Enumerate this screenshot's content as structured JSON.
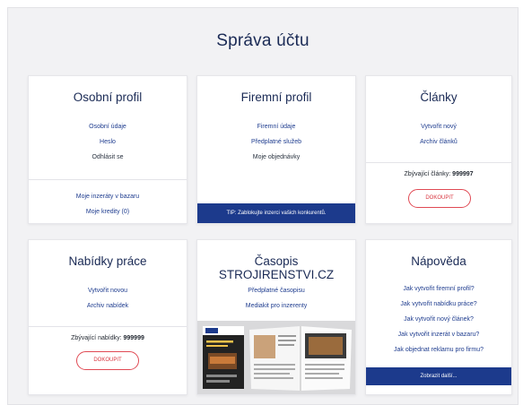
{
  "page": {
    "title": "Správa účtu"
  },
  "cards": {
    "personal": {
      "title": "Osobní profil",
      "links": [
        "Osobní údaje",
        "Heslo",
        "Odhlásit se"
      ],
      "bottom_links": [
        "Moje inzeráty v bazaru",
        "Moje kredity (0)"
      ]
    },
    "company": {
      "title": "Firemní profil",
      "links": [
        "Firemní údaje",
        "Předplatné služeb",
        "Moje objednávky"
      ],
      "tip": "TIP: Zablokujte inzerci vašich konkurentů."
    },
    "articles": {
      "title": "Články",
      "links": [
        "Vytvořit nový",
        "Archiv článků"
      ],
      "remaining_label": "Zbývající články:",
      "remaining_value": "999997",
      "buy_label": "DOKOUPIT"
    },
    "jobs": {
      "title": "Nabídky práce",
      "links": [
        "Vytvořit novou",
        "Archiv nabídek"
      ],
      "remaining_label": "Zbývající nabídky:",
      "remaining_value": "999999",
      "buy_label": "DOKOUPIT"
    },
    "magazine": {
      "title": "Časopis STROJIRENSTVI.CZ",
      "links": [
        "Předplatné časopisu",
        "Mediakit pro inzerenty"
      ]
    },
    "help": {
      "title": "Nápověda",
      "links": [
        "Jak vytvořit firemní profil?",
        "Jak vytvořit nabídku práce?",
        "Jak vytvořit nový článek?",
        "Jak vytvořit inzerát v bazaru?",
        "Jak objednat reklamu pro firmu?"
      ],
      "more_label": "Zobrazit další..."
    }
  },
  "colors": {
    "title": "#1a2a55",
    "link": "#1f3d8f",
    "accent_bar": "#1c3a8c",
    "buy_red": "#e04a54",
    "background": "#f2f2f4"
  }
}
